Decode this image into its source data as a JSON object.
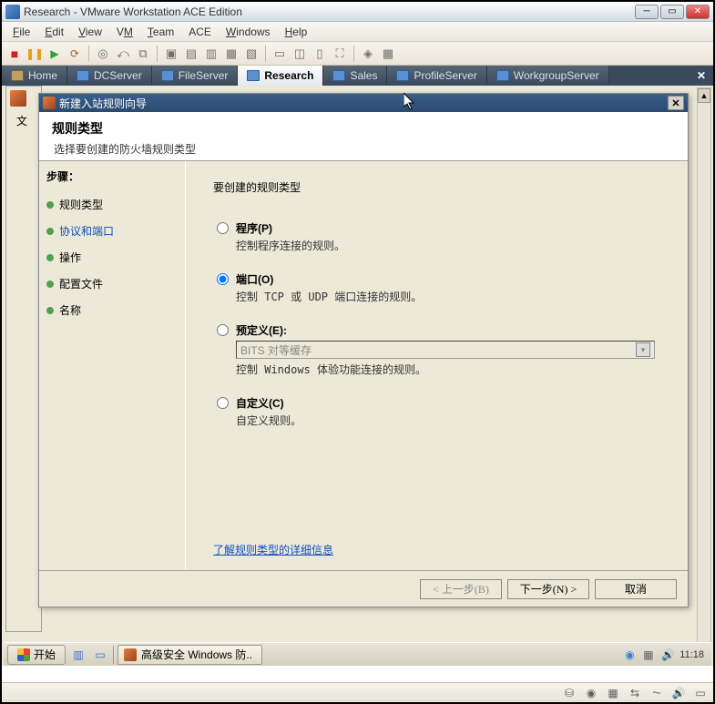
{
  "window": {
    "title": "Research - VMware Workstation ACE Edition"
  },
  "menu": {
    "file": "File",
    "edit": "Edit",
    "view": "View",
    "vm": "VM",
    "team": "Team",
    "ace": "ACE",
    "windows": "Windows",
    "help": "Help"
  },
  "tabs": {
    "home": "Home",
    "dcserver": "DCServer",
    "fileserver": "FileServer",
    "research": "Research",
    "sales": "Sales",
    "profileserver": "ProfileServer",
    "workgroup": "WorkgroupServer"
  },
  "bg_fragment": "文",
  "wizard": {
    "title": "新建入站规则向导",
    "header_title": "规则类型",
    "header_sub": "选择要创建的防火墙规则类型",
    "steps_title": "步骤：",
    "steps": {
      "ruletype": "规则类型",
      "protocol": "协议和端口",
      "action": "操作",
      "profile": "配置文件",
      "name": "名称"
    },
    "prompt": "要创建的规则类型",
    "options": {
      "program_label": "程序(P)",
      "program_desc": "控制程序连接的规则。",
      "port_label": "端口(O)",
      "port_desc": "控制 TCP 或 UDP 端口连接的规则。",
      "predefined_label": "预定义(E):",
      "predefined_combo": "BITS 对等缓存",
      "predefined_desc": "控制 Windows 体验功能连接的规则。",
      "custom_label": "自定义(C)",
      "custom_desc": "自定义规则。"
    },
    "learn_link": "了解规则类型的详细信息",
    "buttons": {
      "back": "< 上一步(B)",
      "next": "下一步(N) >",
      "cancel": "取消"
    }
  },
  "taskbar": {
    "start": "开始",
    "task_firewall": "高级安全 Windows 防..",
    "clock": "11:18"
  }
}
